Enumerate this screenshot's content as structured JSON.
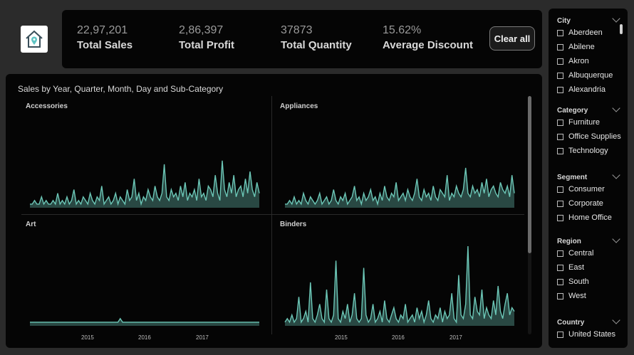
{
  "kpis": {
    "sales": {
      "value": "22,97,201",
      "label": "Total Sales"
    },
    "profit": {
      "value": "2,86,397",
      "label": "Total Profit"
    },
    "quantity": {
      "value": "37873",
      "label": "Total Quantity"
    },
    "discount": {
      "value": "15.62%",
      "label": "Average Discount"
    }
  },
  "clear_button": "Clear all",
  "colors": {
    "series": "#6cc7b7",
    "background": "#050505",
    "page": "#2b2b2b"
  },
  "slicers": {
    "city": {
      "header": "City",
      "items": [
        "Aberdeen",
        "Abilene",
        "Akron",
        "Albuquerque",
        "Alexandria"
      ]
    },
    "category": {
      "header": "Category",
      "items": [
        "Furniture",
        "Office Supplies",
        "Technology"
      ]
    },
    "segment": {
      "header": "Segment",
      "items": [
        "Consumer",
        "Corporate",
        "Home Office"
      ]
    },
    "region": {
      "header": "Region",
      "items": [
        "Central",
        "East",
        "South",
        "West"
      ]
    },
    "country": {
      "header": "Country",
      "items": [
        "United States"
      ]
    }
  },
  "chart_data": {
    "type": "line",
    "title": "Sales by Year, Quarter, Month, Day and Sub-Category",
    "x_ticks": [
      "2015",
      "2016",
      "2017"
    ],
    "x_range": [
      "2014-01",
      "2017-12"
    ],
    "y_axis_shown": false,
    "grid": false,
    "facets": [
      {
        "name": "Accessories",
        "values": [
          1,
          1,
          2,
          1,
          1,
          3,
          1,
          2,
          1,
          1,
          2,
          1,
          4,
          1,
          2,
          1,
          3,
          1,
          2,
          5,
          1,
          2,
          1,
          3,
          2,
          1,
          4,
          2,
          1,
          3,
          2,
          6,
          1,
          2,
          3,
          1,
          2,
          4,
          1,
          3,
          2,
          1,
          5,
          2,
          3,
          8,
          2,
          4,
          1,
          3,
          2,
          5,
          3,
          2,
          6,
          3,
          2,
          4,
          12,
          3,
          2,
          5,
          3,
          4,
          2,
          6,
          3,
          7,
          2,
          4,
          3,
          5,
          2,
          8,
          3,
          4,
          2,
          6,
          5,
          3,
          9,
          4,
          2,
          13,
          5,
          3,
          7,
          4,
          9,
          3,
          5,
          6,
          3,
          8,
          4,
          10,
          5,
          3,
          7,
          4
        ]
      },
      {
        "name": "Appliances",
        "values": [
          1,
          1,
          2,
          1,
          3,
          1,
          2,
          1,
          4,
          2,
          1,
          3,
          2,
          1,
          2,
          4,
          1,
          2,
          3,
          1,
          2,
          5,
          2,
          1,
          3,
          2,
          4,
          1,
          2,
          3,
          6,
          2,
          3,
          1,
          4,
          2,
          3,
          5,
          2,
          3,
          1,
          4,
          2,
          6,
          3,
          2,
          4,
          3,
          7,
          2,
          3,
          4,
          2,
          5,
          3,
          2,
          4,
          8,
          3,
          2,
          5,
          3,
          4,
          2,
          6,
          3,
          2,
          5,
          4,
          3,
          9,
          2,
          4,
          3,
          6,
          4,
          3,
          5,
          11,
          4,
          3,
          6,
          4,
          5,
          3,
          7,
          4,
          8,
          3,
          5,
          6,
          4,
          3,
          7,
          5,
          4,
          6,
          3,
          9,
          4
        ]
      },
      {
        "name": "Art",
        "values": [
          1,
          1,
          1,
          1,
          1,
          1,
          1,
          1,
          1,
          1,
          1,
          1,
          1,
          1,
          1,
          1,
          1,
          1,
          1,
          1,
          1,
          1,
          1,
          1,
          1,
          1,
          1,
          1,
          1,
          1,
          1,
          1,
          1,
          1,
          1,
          1,
          1,
          1,
          1,
          2,
          1,
          1,
          1,
          1,
          1,
          1,
          1,
          1,
          1,
          1,
          1,
          1,
          1,
          1,
          1,
          1,
          1,
          1,
          1,
          1,
          1,
          1,
          1,
          1,
          1,
          1,
          1,
          1,
          1,
          1,
          1,
          1,
          1,
          1,
          1,
          1,
          1,
          1,
          1,
          1,
          1,
          1,
          1,
          1,
          1,
          1,
          1,
          1,
          1,
          1,
          1,
          1,
          1,
          1,
          1,
          1,
          1,
          1,
          1,
          1
        ]
      },
      {
        "name": "Binders",
        "values": [
          1,
          2,
          1,
          3,
          1,
          2,
          8,
          1,
          2,
          4,
          1,
          12,
          2,
          1,
          3,
          6,
          2,
          1,
          10,
          2,
          1,
          3,
          18,
          2,
          1,
          4,
          2,
          6,
          1,
          3,
          9,
          2,
          1,
          2,
          16,
          3,
          1,
          2,
          6,
          1,
          2,
          4,
          1,
          7,
          2,
          1,
          3,
          5,
          2,
          1,
          3,
          2,
          6,
          1,
          2,
          3,
          1,
          5,
          2,
          4,
          1,
          3,
          7,
          2,
          1,
          3,
          2,
          5,
          1,
          4,
          2,
          3,
          9,
          2,
          1,
          14,
          3,
          2,
          6,
          22,
          3,
          2,
          8,
          4,
          3,
          10,
          2,
          5,
          3,
          2,
          7,
          3,
          11,
          4,
          2,
          6,
          9,
          3,
          5,
          4
        ]
      }
    ]
  }
}
